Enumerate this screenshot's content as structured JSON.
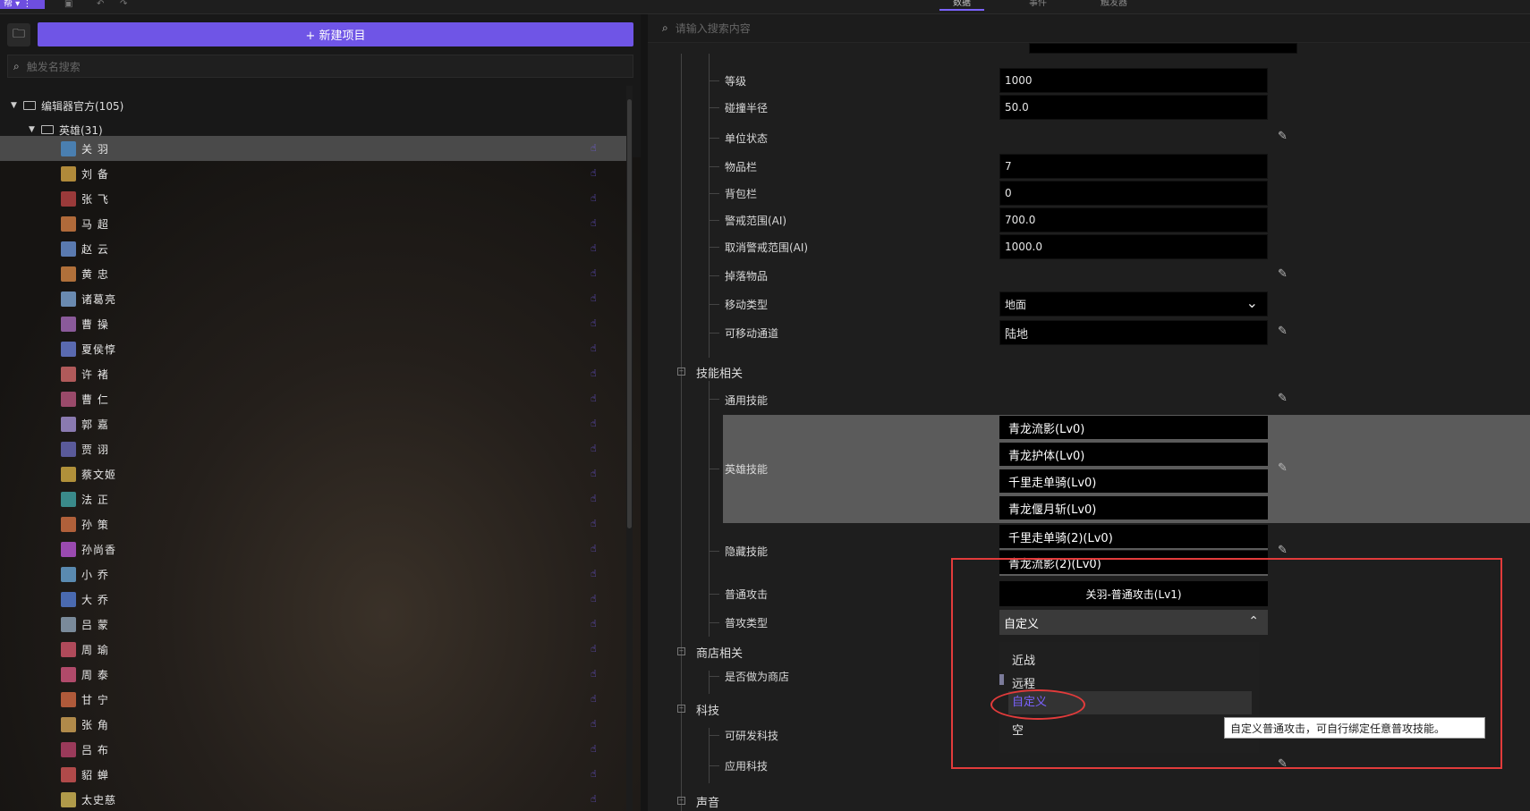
{
  "topbar": {
    "tabs": [
      "数据",
      "事件",
      "触发器"
    ],
    "active_tab": 0
  },
  "left": {
    "new_project_label": "+ 新建项目",
    "search_placeholder": "触发名搜索",
    "root_folder": "编辑器官方(105)",
    "sub_folder": "英雄(31)",
    "heroes": [
      "关 羽",
      "刘 备",
      "张 飞",
      "马 超",
      "赵 云",
      "黄 忠",
      "诸葛亮",
      "曹 操",
      "夏侯惇",
      "许 褚",
      "曹 仁",
      "郭 嘉",
      "贾 诩",
      "蔡文姬",
      "法 正",
      "孙 策",
      "孙尚香",
      "小 乔",
      "大 乔",
      "吕 蒙",
      "周 瑜",
      "周 泰",
      "甘 宁",
      "张 角",
      "吕 布",
      "貂 蝉",
      "太史慈"
    ],
    "avatar_colors": [
      "#4a7fb0",
      "#b08a3a",
      "#9a3a3a",
      "#b06a3a",
      "#5a7ab0",
      "#b0703a",
      "#6a8ab0",
      "#8a5a9a",
      "#5a6ab0",
      "#b05a5a",
      "#9a4a6a",
      "#8a7ab0",
      "#5a5a9a",
      "#b0903a",
      "#3a8a8a",
      "#b0603a",
      "#9a4ab0",
      "#5a8ab0",
      "#4a6ab0",
      "#7a8a9a",
      "#b04a5a",
      "#b04a6a",
      "#b05a3a",
      "#b08a4a",
      "#9a3a5a",
      "#b04a4a",
      "#b09a4a"
    ],
    "selected_index": 0
  },
  "right": {
    "search_placeholder": "请输入搜索内容",
    "props": [
      {
        "label": "等级",
        "value": "1000"
      },
      {
        "label": "碰撞半径",
        "value": "50.0"
      },
      {
        "label": "单位状态",
        "value": ""
      },
      {
        "label": "物品栏",
        "value": "7"
      },
      {
        "label": "背包栏",
        "value": "0"
      },
      {
        "label": "警戒范围(AI)",
        "value": "700.0"
      },
      {
        "label": "取消警戒范围(AI)",
        "value": "1000.0"
      },
      {
        "label": "掉落物品",
        "value": ""
      },
      {
        "label": "移动类型",
        "value": "地面"
      },
      {
        "label": "可移动通道",
        "value": "陆地"
      }
    ],
    "section_skill": "技能相关",
    "common_skill": "通用技能",
    "hero_skill": "英雄技能",
    "hero_skills": [
      "青龙流影(Lv0)",
      "青龙护体(Lv0)",
      "千里走单骑(Lv0)",
      "青龙偃月斩(Lv0)"
    ],
    "hidden_skill": "隐藏技能",
    "hidden_skills": [
      "千里走单骑(2)(Lv0)",
      "青龙流影(2)(Lv0)"
    ],
    "normal_attack": "普通攻击",
    "normal_attack_value": "关羽-普通攻击(Lv1)",
    "attack_type": "普攻类型",
    "attack_type_value": "自定义",
    "attack_type_options": [
      "近战",
      "远程",
      "自定义",
      "空"
    ],
    "section_shop": "商店相关",
    "is_shop": "是否做为商店",
    "section_tech": "科技",
    "tech_research": "可研发科技",
    "tech_apply": "应用科技",
    "section_sound": "声音",
    "tooltip": "自定义普通攻击，可自行绑定任意普攻技能。"
  }
}
